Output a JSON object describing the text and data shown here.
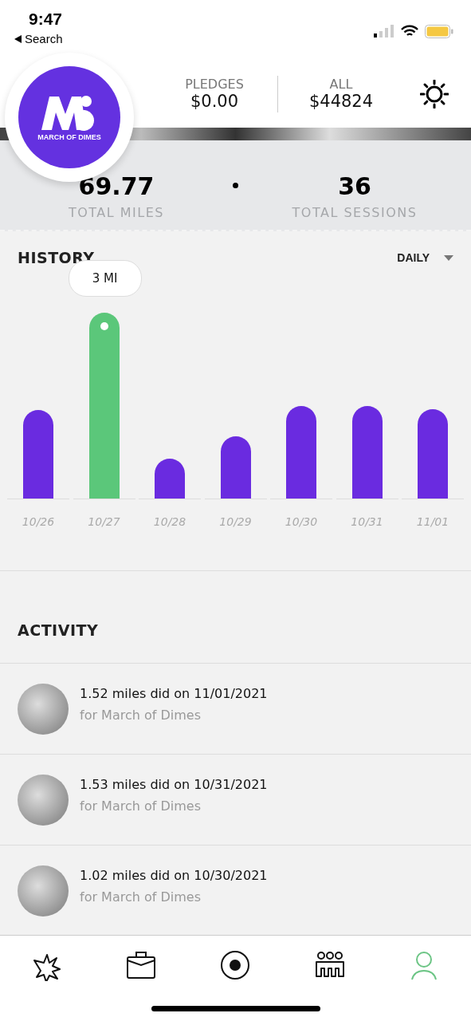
{
  "status_bar": {
    "time": "9:47",
    "back_label": "Search"
  },
  "header": {
    "logo_text": "MARCH OF DIMES",
    "stats": [
      {
        "label": "PLEDGES",
        "value": "$0.00"
      },
      {
        "label": "ALL",
        "value": "$44824"
      }
    ]
  },
  "totals": [
    {
      "value": "69.77",
      "label": "TOTAL MILES"
    },
    {
      "value": "36",
      "label": "TOTAL SESSIONS"
    }
  ],
  "history": {
    "title": "HISTORY",
    "period": "DAILY",
    "tooltip": "3 MI",
    "bars": [
      {
        "date": "10/26",
        "selected": false
      },
      {
        "date": "10/27",
        "selected": true
      },
      {
        "date": "10/28",
        "selected": false
      },
      {
        "date": "10/29",
        "selected": false
      },
      {
        "date": "10/30",
        "selected": false
      },
      {
        "date": "10/31",
        "selected": false
      },
      {
        "date": "11/01",
        "selected": false
      }
    ]
  },
  "activity": {
    "title": "ACTIVITY",
    "items": [
      {
        "text": "1.52 miles did on 11/01/2021",
        "subtitle": "for March of Dimes"
      },
      {
        "text": "1.53 miles did on 10/31/2021",
        "subtitle": "for March of Dimes"
      },
      {
        "text": "1.02 miles did on 10/30/2021",
        "subtitle": "for March of Dimes"
      }
    ]
  },
  "tab_bar": [
    {
      "kind": "burst",
      "selected": false
    },
    {
      "kind": "briefcase",
      "selected": false
    },
    {
      "kind": "record",
      "selected": false
    },
    {
      "kind": "team",
      "selected": false
    },
    {
      "kind": "profile",
      "selected": true
    }
  ]
}
